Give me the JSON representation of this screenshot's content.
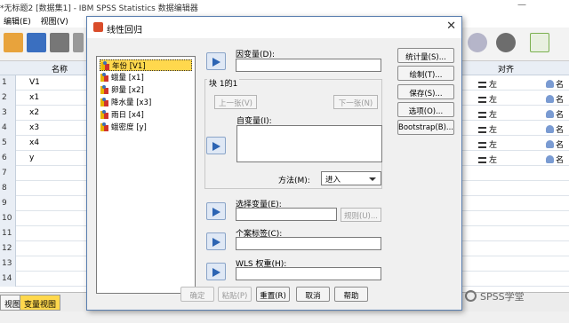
{
  "window": {
    "title": "*无标题2 [数据集1] - IBM SPSS Statistics 数据编辑器"
  },
  "menu": [
    "编辑(E)",
    "视图(V)"
  ],
  "grid": {
    "col_name": "名称",
    "col_align": "对齐",
    "rows": [
      {
        "num": "1",
        "name": "V1",
        "align": "左",
        "role": "名"
      },
      {
        "num": "2",
        "name": "x1",
        "align": "左",
        "role": "名"
      },
      {
        "num": "3",
        "name": "x2",
        "align": "左",
        "role": "名"
      },
      {
        "num": "4",
        "name": "x3",
        "align": "左",
        "role": "名"
      },
      {
        "num": "5",
        "name": "x4",
        "align": "左",
        "role": "名"
      },
      {
        "num": "6",
        "name": "y",
        "align": "左",
        "role": "名"
      },
      {
        "num": "7",
        "name": "",
        "align": "",
        "role": ""
      },
      {
        "num": "8",
        "name": "",
        "align": "",
        "role": ""
      },
      {
        "num": "9",
        "name": "",
        "align": "",
        "role": ""
      },
      {
        "num": "10",
        "name": "",
        "align": "",
        "role": ""
      },
      {
        "num": "11",
        "name": "",
        "align": "",
        "role": ""
      },
      {
        "num": "12",
        "name": "",
        "align": "",
        "role": ""
      },
      {
        "num": "13",
        "name": "",
        "align": "",
        "role": ""
      },
      {
        "num": "14",
        "name": "",
        "align": "",
        "role": ""
      }
    ]
  },
  "bottom_tabs": {
    "data_view": "视图",
    "variable_view": "变量视图"
  },
  "watermark": "SPSS学堂",
  "dialog": {
    "title": "线性回归",
    "variables": [
      "年份 [V1]",
      "蛾量 [x1]",
      "卵量 [x2]",
      "降水量 [x3]",
      "雨日 [x4]",
      "蛾密度 [y]"
    ],
    "dependent_label": "因变量(D):",
    "block_label": "块 1的1",
    "prev_button": "上一张(V)",
    "next_button": "下一张(N)",
    "independent_label": "自变量(I):",
    "method_label": "方法(M):",
    "method_value": "进入",
    "selection_label": "选择变量(E):",
    "rule_button": "规则(U)...",
    "case_label": "个案标签(C):",
    "wls_label": "WLS 权重(H):",
    "side_buttons": [
      "统计量(S)...",
      "绘制(T)...",
      "保存(S)...",
      "选项(O)...",
      "Bootstrap(B)..."
    ],
    "bottom_buttons": {
      "ok": "确定",
      "paste": "粘贴(P)",
      "reset": "重置(R)",
      "cancel": "取消",
      "help": "帮助"
    }
  },
  "colors": {
    "accent": "#2c64b3",
    "selected": "#ffd84d"
  }
}
